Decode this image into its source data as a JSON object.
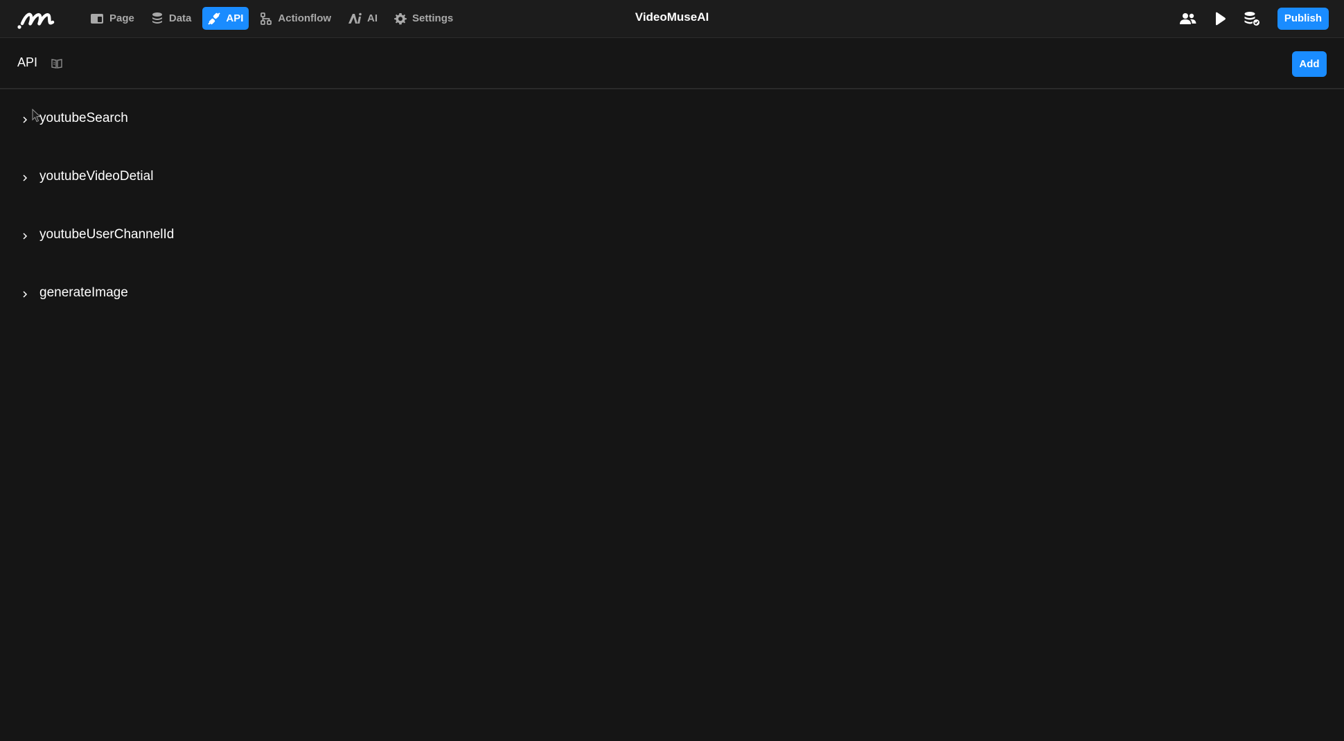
{
  "app": {
    "title": "VideoMuseAI",
    "logo_icon": "brand-logo-icon",
    "accent_color": "#1a8cff"
  },
  "nav": {
    "items": [
      {
        "label": "Page",
        "icon": "page-icon",
        "active": false
      },
      {
        "label": "Data",
        "icon": "database-icon",
        "active": false
      },
      {
        "label": "API",
        "icon": "plug-icon",
        "active": true
      },
      {
        "label": "Actionflow",
        "icon": "flow-icon",
        "active": false
      },
      {
        "label": "AI",
        "icon": "ai-icon",
        "active": false
      },
      {
        "label": "Settings",
        "icon": "gear-icon",
        "active": false
      }
    ]
  },
  "toolbar": {
    "icons": [
      "users-icon",
      "play-icon",
      "database-check-icon"
    ],
    "publish_label": "Publish"
  },
  "header": {
    "title": "API",
    "doc_icon": "book-icon",
    "add_label": "Add"
  },
  "apis": [
    {
      "name": "youtubeSearch"
    },
    {
      "name": "youtubeVideoDetial"
    },
    {
      "name": "youtubeUserChannelId"
    },
    {
      "name": "generateImage"
    }
  ]
}
